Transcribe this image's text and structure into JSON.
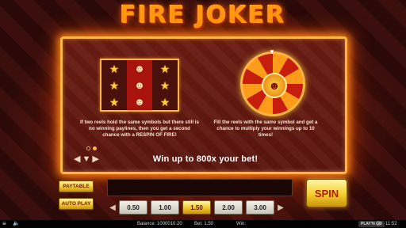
{
  "game": {
    "title": "FIRE JOKER"
  },
  "info_page": {
    "left_description": "If two reels hold the same symbols but there still is no winning paylines, then you get a second chance with a RESPIN OF FIRE!",
    "right_description": "Fill the reels with the same symbol and get a chance to multiply your winnings up to 10 times!",
    "headline": "Win up to 800x your bet!",
    "page_indicator": {
      "current": 2,
      "total": 2
    },
    "reel_grid": [
      [
        "star-icon",
        "joker-icon",
        "star-icon"
      ],
      [
        "star-icon",
        "joker-icon",
        "star-icon"
      ],
      [
        "star-icon",
        "joker-icon",
        "star-icon"
      ]
    ]
  },
  "controls": {
    "paytable_label": "PAYTABLE",
    "autoplay_label": "AUTO PLAY",
    "spin_label": "SPIN",
    "bet_options": [
      "0.50",
      "1.00",
      "1.50",
      "2.00",
      "3.00"
    ],
    "selected_bet": "1.50",
    "colors": {
      "accent": "#f2c72e",
      "frame": "#ffb545",
      "title": "#ff9a10"
    }
  },
  "status_bar": {
    "balance": "Balance: 1000010.20",
    "bet": "Bet: 1.50",
    "win": "Win:",
    "logo": "PLAY'N GO",
    "time": "11:52"
  }
}
